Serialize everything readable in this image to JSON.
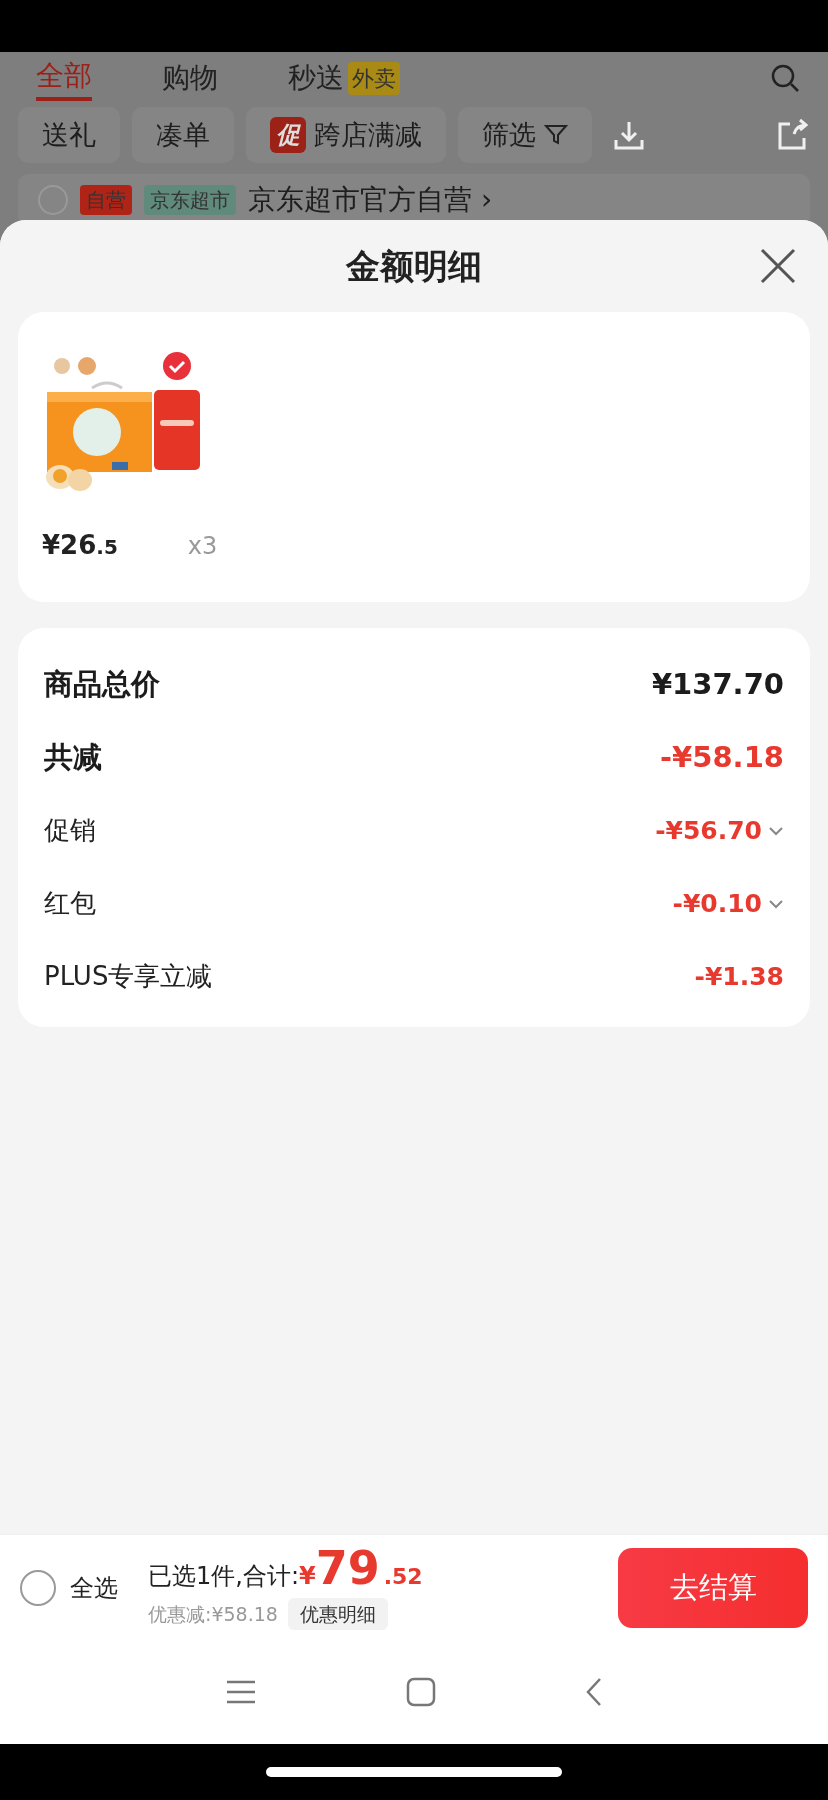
{
  "background_page": {
    "tabs": [
      {
        "label": "全部",
        "selected": true
      },
      {
        "label": "购物",
        "selected": false
      },
      {
        "label": "秒送",
        "selected": false,
        "badge": "外卖"
      }
    ],
    "filters": [
      {
        "label": "送礼",
        "kind": "plain"
      },
      {
        "label": "凑单",
        "kind": "plain"
      },
      {
        "label": "跨店满减",
        "kind": "promo",
        "tag": "促"
      },
      {
        "label": "筛选",
        "kind": "filter"
      }
    ],
    "store": {
      "checked": false,
      "tags": [
        {
          "text": "自营",
          "color": "#b02418"
        },
        {
          "text": "京东超市",
          "color": "#5f8a7c"
        }
      ],
      "name": "京东超市官方自营 ›"
    }
  },
  "sheet": {
    "title": "金额明细",
    "items": [
      {
        "kind": "picture",
        "price_main": "¥26",
        "price_decimal": ".5",
        "quantity": "x3"
      }
    ],
    "summary": [
      {
        "label": "商品总价",
        "value": "¥137.70",
        "kind": "total",
        "expandable": false
      },
      {
        "label": "共减",
        "value": "-¥58.18",
        "kind": "discount_total",
        "expandable": false
      },
      {
        "label": "促销",
        "value": "-¥56.70",
        "kind": "detail",
        "expandable": true
      },
      {
        "label": "红包",
        "value": "-¥0.10",
        "kind": "detail",
        "expandable": true
      },
      {
        "label": "PLUS专享立减",
        "value": "-¥1.38",
        "kind": "detail",
        "expandable": false
      }
    ]
  },
  "checkout_bar": {
    "select_all": {
      "label": "全选",
      "checked": false
    },
    "selected_text": "已选1件,合计:",
    "currency": "¥",
    "total_main": "79",
    "total_decimal": ".52",
    "discount_text": "优惠减:¥58.18",
    "details_button": "优惠明细",
    "checkout_button": "去结算"
  }
}
